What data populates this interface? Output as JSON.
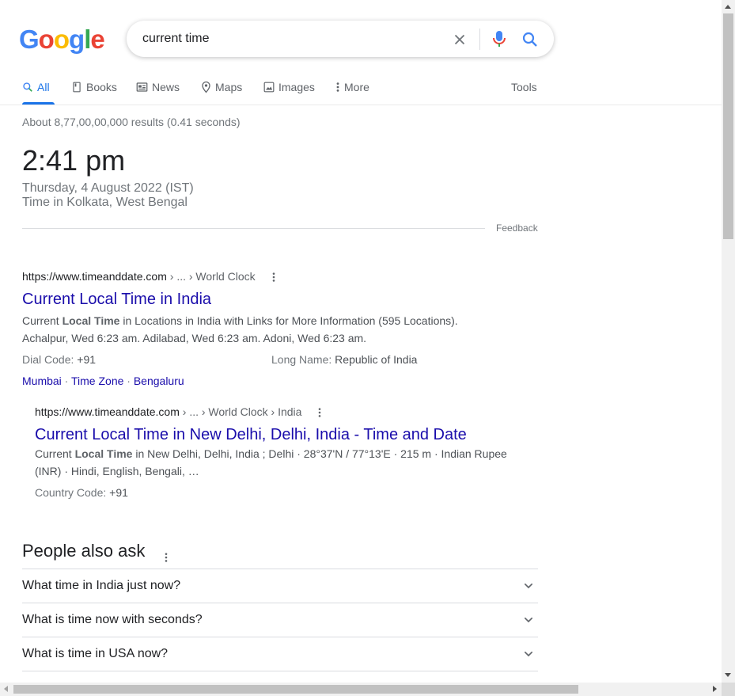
{
  "logo": {
    "g1": "G",
    "o1": "o",
    "o2": "o",
    "g2": "g",
    "l": "l",
    "e": "e"
  },
  "search": {
    "value": "current time",
    "clear_icon": "close-icon",
    "mic_icon": "mic-icon",
    "search_icon": "search-icon"
  },
  "tabs": [
    {
      "label": "All",
      "icon": "search-icon",
      "active": true
    },
    {
      "label": "Books",
      "icon": "book-icon"
    },
    {
      "label": "News",
      "icon": "news-icon"
    },
    {
      "label": "Maps",
      "icon": "map-pin-icon"
    },
    {
      "label": "Images",
      "icon": "image-icon"
    },
    {
      "label": "More",
      "icon": "more-vert-icon"
    }
  ],
  "tools_label": "Tools",
  "stats": "About 8,77,00,00,000 results (0.41 seconds)",
  "time_card": {
    "time": "2:41 pm",
    "date": "Thursday, 4 August 2022 (IST)",
    "location": "Time in Kolkata, West Bengal",
    "feedback": "Feedback"
  },
  "result1": {
    "url": "https://www.timeanddate.com",
    "breadcrumb": " › ... › World Clock",
    "title": "Current Local Time in India",
    "snippet_pre": "Current ",
    "snippet_bold": "Local Time",
    "snippet_post": " in Locations in India with Links for More Information (595 Locations).",
    "snippet_line2": "Achalpur, Wed 6:23 am. Adilabad, Wed 6:23 am. Adoni, Wed 6:23 am.",
    "fact1_label": "Dial Code: ",
    "fact1_value": "+91",
    "fact2_label": "Long Name: ",
    "fact2_value": "Republic of India",
    "sitelinks": [
      "Mumbai",
      "Time Zone",
      "Bengaluru"
    ],
    "sep": " · "
  },
  "result2": {
    "url": "https://www.timeanddate.com",
    "breadcrumb": " › ... › World Clock › India",
    "title": "Current Local Time in New Delhi, Delhi, India - Time and Date",
    "snippet_pre": "Current ",
    "snippet_bold": "Local Time",
    "snippet_post": " in New Delhi, Delhi, India ; Delhi · 28°37'N / 77°13'E · 215 m · Indian Rupee",
    "snippet_line2": "(INR) · Hindi, English, Bengali, …",
    "fact_label": "Country Code: ",
    "fact_value": "+91"
  },
  "paa": {
    "title": "People also ask",
    "questions": [
      "What time in India just now?",
      "What is time now with seconds?",
      "What is time in USA now?"
    ]
  },
  "colors": {
    "link": "#1a0dab",
    "accent": "#1a73e8",
    "muted": "#70757a"
  }
}
